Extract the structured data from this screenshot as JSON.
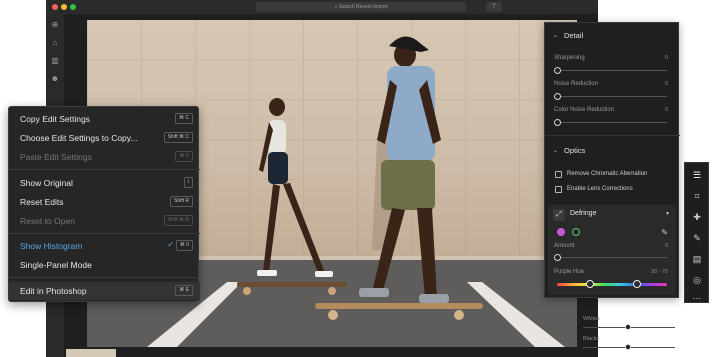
{
  "app": {
    "search_placeholder": "Search Recent Import"
  },
  "context_menu": {
    "items": [
      {
        "label": "Copy Edit Settings",
        "shortcut": "⌘ C",
        "enabled": true
      },
      {
        "label": "Choose Edit Settings to Copy...",
        "shortcut": "Shift ⌘ C",
        "enabled": true
      },
      {
        "label": "Paste Edit Settings",
        "shortcut": "⌘ V",
        "enabled": false
      },
      {
        "label": "Show Original",
        "shortcut": "\\",
        "enabled": true
      },
      {
        "label": "Reset Edits",
        "shortcut": "Shift R",
        "enabled": true
      },
      {
        "label": "Reset to Open",
        "shortcut": "Shift ⌘ R",
        "enabled": false
      },
      {
        "label": "Show Histogram",
        "shortcut": "⌘ 0",
        "enabled": true,
        "checked": true
      },
      {
        "label": "Single-Panel Mode",
        "enabled": true
      },
      {
        "label": "Edit in Photoshop",
        "shortcut": "⌘ E",
        "enabled": true
      }
    ]
  },
  "detail_panel": {
    "detail_title": "Detail",
    "sharpening": {
      "label": "Sharpening",
      "value": "0"
    },
    "noise_reduction": {
      "label": "Noise Reduction",
      "value": "0"
    },
    "color_noise_reduction": {
      "label": "Color Noise Reduction",
      "value": "0"
    },
    "optics_title": "Optics",
    "remove_ca": "Remove Chromatic Aberration",
    "enable_lens": "Enable Lens Corrections",
    "defringe": {
      "title": "Defringe",
      "amount_label": "Amount",
      "amount_value": "0",
      "purple_hue_label": "Purple Hue",
      "purple_hue_value": "30 - 70",
      "purple_color": "#c65ad6",
      "green_color": "#62c862"
    }
  },
  "lower_sliders": [
    {
      "label": "Whites"
    },
    {
      "label": "Blacks"
    }
  ],
  "colors": {
    "accent": "#5aa6e8",
    "menu_bg": "#262626"
  }
}
